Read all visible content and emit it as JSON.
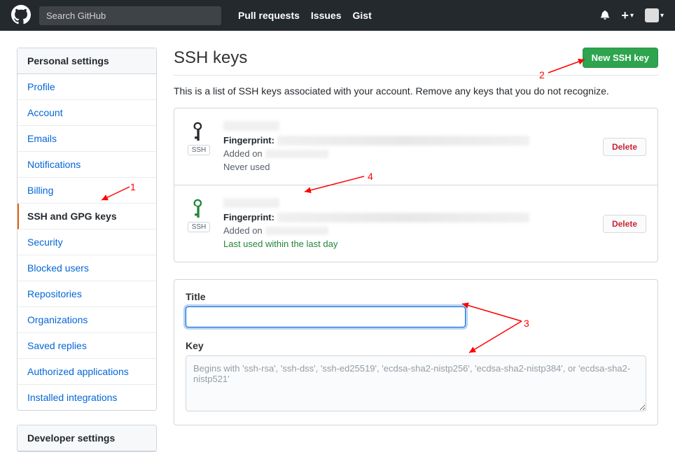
{
  "header": {
    "search_placeholder": "Search GitHub",
    "nav": {
      "pull_requests": "Pull requests",
      "issues": "Issues",
      "gist": "Gist"
    }
  },
  "sidebar": {
    "personal_header": "Personal settings",
    "items": [
      {
        "label": "Profile"
      },
      {
        "label": "Account"
      },
      {
        "label": "Emails"
      },
      {
        "label": "Notifications"
      },
      {
        "label": "Billing"
      },
      {
        "label": "SSH and GPG keys"
      },
      {
        "label": "Security"
      },
      {
        "label": "Blocked users"
      },
      {
        "label": "Repositories"
      },
      {
        "label": "Organizations"
      },
      {
        "label": "Saved replies"
      },
      {
        "label": "Authorized applications"
      },
      {
        "label": "Installed integrations"
      }
    ],
    "dev_header": "Developer settings"
  },
  "page": {
    "title": "SSH keys",
    "new_button": "New SSH key",
    "description": "This is a list of SSH keys associated with your account. Remove any keys that you do not recognize."
  },
  "keys": [
    {
      "fingerprint_label": "Fingerprint:",
      "added_label": "Added on",
      "usage": "Never used",
      "usage_class": "never",
      "icon_color": "#24292e",
      "badge": "SSH",
      "delete": "Delete"
    },
    {
      "fingerprint_label": "Fingerprint:",
      "added_label": "Added on",
      "usage": "Last used within the last day",
      "usage_class": "recent",
      "icon_color": "#22863a",
      "badge": "SSH",
      "delete": "Delete"
    }
  ],
  "form": {
    "title_label": "Title",
    "key_label": "Key",
    "key_placeholder": "Begins with 'ssh-rsa', 'ssh-dss', 'ssh-ed25519', 'ecdsa-sha2-nistp256', 'ecdsa-sha2-nistp384', or 'ecdsa-sha2-nistp521'"
  },
  "annotations": {
    "a1": "1",
    "a2": "2",
    "a3": "3",
    "a4": "4"
  }
}
